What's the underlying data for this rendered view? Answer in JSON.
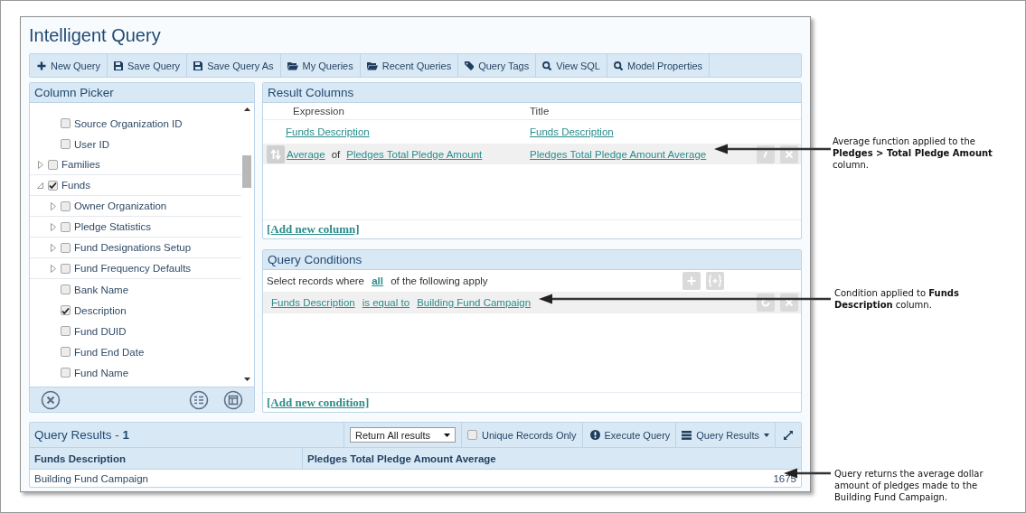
{
  "window": {
    "title": "Intelligent Query"
  },
  "toolbar": [
    "New Query",
    "Save Query",
    "Save Query As",
    "My Queries",
    "Recent Queries",
    "Query Tags",
    "View SQL",
    "Model Properties"
  ],
  "column_picker": {
    "title": "Column Picker",
    "tree": [
      {
        "children": [
          {
            "label": "Source Organization ID",
            "checked": false
          },
          {
            "label": "User ID",
            "checked": false
          }
        ]
      },
      {
        "label": "Families",
        "checked": false,
        "expanded": false
      },
      {
        "label": "Funds",
        "checked": true,
        "expanded": true,
        "children": [
          {
            "label": "Owner Organization",
            "checked": false,
            "expanded": false
          },
          {
            "label": "Pledge Statistics",
            "checked": false,
            "expanded": false
          },
          {
            "label": "Fund Designations Setup",
            "checked": false,
            "expanded": false
          },
          {
            "label": "Fund Frequency Defaults",
            "checked": false,
            "expanded": false
          },
          {
            "label": "Bank Name",
            "checked": false
          },
          {
            "label": "Description",
            "checked": true
          },
          {
            "label": "Fund DUID",
            "checked": false
          },
          {
            "label": "Fund End Date",
            "checked": false
          },
          {
            "label": "Fund Name",
            "checked": false
          }
        ]
      }
    ]
  },
  "result_columns": {
    "title": "Result Columns",
    "columns": [
      "Expression",
      "Title"
    ],
    "rows": [
      {
        "expression": [
          {
            "kind": "link",
            "text": "Funds Description"
          }
        ],
        "title": "Funds Description",
        "selected": false
      },
      {
        "expression": [
          {
            "kind": "link",
            "text": "Average"
          },
          {
            "kind": "text",
            "text": "of"
          },
          {
            "kind": "link",
            "text": "Pledges Total Pledge Amount"
          }
        ],
        "title": "Pledges Total Pledge Amount Average",
        "selected": true
      }
    ],
    "add_link": "[Add new column]"
  },
  "query_conditions": {
    "title": "Query Conditions",
    "intro_before": "Select records where",
    "match": "all",
    "intro_after": "of the following apply",
    "conditions": [
      {
        "parts": [
          "Funds Description",
          "is equal to",
          "Building Fund Campaign"
        ],
        "selected": true
      }
    ],
    "add_link": "[Add new condition]"
  },
  "query_results": {
    "title": "Query Results - **1**",
    "return_mode": "Return All results",
    "unique_records": {
      "label": "Unique Records Only",
      "checked": false
    },
    "execute": "Execute Query",
    "results_menu": "Query Results",
    "columns": [
      "Funds Description",
      "Pledges Total Pledge Amount Average"
    ],
    "rows": [
      [
        "Building Fund Campaign",
        "1675"
      ]
    ]
  },
  "callouts": [
    {
      "text": "Average function applied to the **Pledges > Total Pledge Amount** column."
    },
    {
      "text": "Condition applied to **Funds Description** column."
    },
    {
      "text": "Query returns the average dollar amount of pledges made to the Building Fund Campaign."
    }
  ]
}
